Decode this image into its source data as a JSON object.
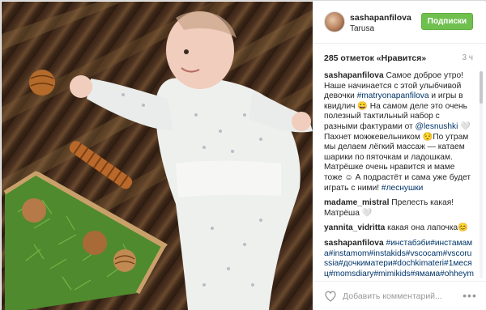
{
  "header": {
    "username": "sashapanfilova",
    "location": "Tarusa",
    "follow_label": "Подписки"
  },
  "likes": {
    "text": "285 отметок «Нравится»",
    "time": "3 ч"
  },
  "caption": {
    "user": "sashapanfilova",
    "text_1": "Самое доброе утро! Наше начинается с этой улыбчивой девочки ",
    "tag_1": "#matryonapanfilova",
    "text_2": " и игры в квидлич 😀 На самом деле это очень полезный тактильный набор с разными фактурами от ",
    "tag_2": "@lesnushki",
    "text_3": " 🤍 Пахнет можжевельником 😌По утрам мы делаем лёгкий массаж — катаем шарики по пяточкам и ладошкам. Матрёшке очень нравится и маме тоже ☺ А подрастёт и сама уже будет играть с ними! ",
    "tag_3": "#леснушки"
  },
  "comments": [
    {
      "user": "madame_mistral",
      "text": "Прелесть какая! Матрёша 🤍"
    },
    {
      "user": "yannita_vidritta",
      "text": "какая она лапочка😊"
    }
  ],
  "hashtags_comment": {
    "user": "sashapanfilova",
    "text": "#инстабэби#инстамама#instamom#instakids#vscocam#vscorussia#дочкиматери#dochkimateri#1месяц#momsdiary#mimikids#ямама#ohheymama#motherhood#деревянныеигруш"
  },
  "footer": {
    "comment_placeholder": "Добавить комментарий...",
    "more_label": "•••"
  },
  "colors": {
    "follow_button": "#70c050",
    "tag_link": "#003569",
    "muted": "#999999"
  },
  "icons": {
    "like": "heart-icon",
    "options": "more-options-icon"
  }
}
